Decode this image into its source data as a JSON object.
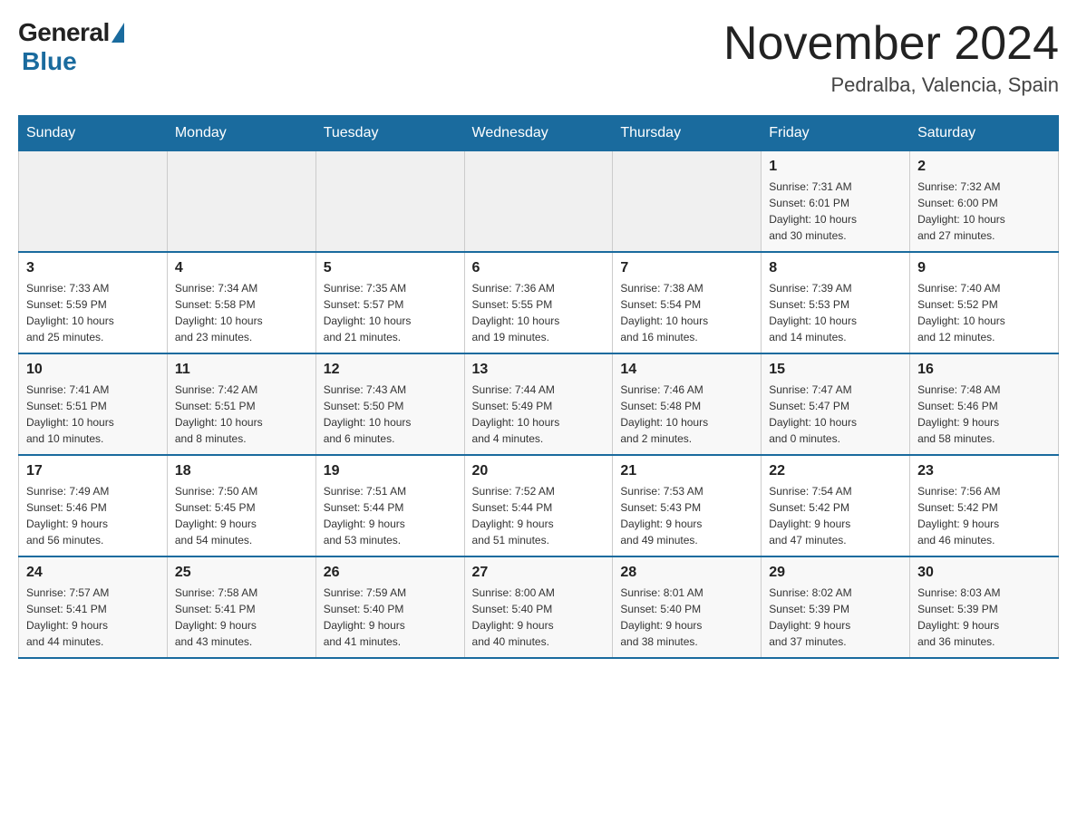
{
  "logo": {
    "general_text": "General",
    "blue_text": "Blue"
  },
  "header": {
    "month_title": "November 2024",
    "location": "Pedralba, Valencia, Spain"
  },
  "weekdays": [
    "Sunday",
    "Monday",
    "Tuesday",
    "Wednesday",
    "Thursday",
    "Friday",
    "Saturday"
  ],
  "weeks": [
    [
      {
        "day": "",
        "info": ""
      },
      {
        "day": "",
        "info": ""
      },
      {
        "day": "",
        "info": ""
      },
      {
        "day": "",
        "info": ""
      },
      {
        "day": "",
        "info": ""
      },
      {
        "day": "1",
        "info": "Sunrise: 7:31 AM\nSunset: 6:01 PM\nDaylight: 10 hours\nand 30 minutes."
      },
      {
        "day": "2",
        "info": "Sunrise: 7:32 AM\nSunset: 6:00 PM\nDaylight: 10 hours\nand 27 minutes."
      }
    ],
    [
      {
        "day": "3",
        "info": "Sunrise: 7:33 AM\nSunset: 5:59 PM\nDaylight: 10 hours\nand 25 minutes."
      },
      {
        "day": "4",
        "info": "Sunrise: 7:34 AM\nSunset: 5:58 PM\nDaylight: 10 hours\nand 23 minutes."
      },
      {
        "day": "5",
        "info": "Sunrise: 7:35 AM\nSunset: 5:57 PM\nDaylight: 10 hours\nand 21 minutes."
      },
      {
        "day": "6",
        "info": "Sunrise: 7:36 AM\nSunset: 5:55 PM\nDaylight: 10 hours\nand 19 minutes."
      },
      {
        "day": "7",
        "info": "Sunrise: 7:38 AM\nSunset: 5:54 PM\nDaylight: 10 hours\nand 16 minutes."
      },
      {
        "day": "8",
        "info": "Sunrise: 7:39 AM\nSunset: 5:53 PM\nDaylight: 10 hours\nand 14 minutes."
      },
      {
        "day": "9",
        "info": "Sunrise: 7:40 AM\nSunset: 5:52 PM\nDaylight: 10 hours\nand 12 minutes."
      }
    ],
    [
      {
        "day": "10",
        "info": "Sunrise: 7:41 AM\nSunset: 5:51 PM\nDaylight: 10 hours\nand 10 minutes."
      },
      {
        "day": "11",
        "info": "Sunrise: 7:42 AM\nSunset: 5:51 PM\nDaylight: 10 hours\nand 8 minutes."
      },
      {
        "day": "12",
        "info": "Sunrise: 7:43 AM\nSunset: 5:50 PM\nDaylight: 10 hours\nand 6 minutes."
      },
      {
        "day": "13",
        "info": "Sunrise: 7:44 AM\nSunset: 5:49 PM\nDaylight: 10 hours\nand 4 minutes."
      },
      {
        "day": "14",
        "info": "Sunrise: 7:46 AM\nSunset: 5:48 PM\nDaylight: 10 hours\nand 2 minutes."
      },
      {
        "day": "15",
        "info": "Sunrise: 7:47 AM\nSunset: 5:47 PM\nDaylight: 10 hours\nand 0 minutes."
      },
      {
        "day": "16",
        "info": "Sunrise: 7:48 AM\nSunset: 5:46 PM\nDaylight: 9 hours\nand 58 minutes."
      }
    ],
    [
      {
        "day": "17",
        "info": "Sunrise: 7:49 AM\nSunset: 5:46 PM\nDaylight: 9 hours\nand 56 minutes."
      },
      {
        "day": "18",
        "info": "Sunrise: 7:50 AM\nSunset: 5:45 PM\nDaylight: 9 hours\nand 54 minutes."
      },
      {
        "day": "19",
        "info": "Sunrise: 7:51 AM\nSunset: 5:44 PM\nDaylight: 9 hours\nand 53 minutes."
      },
      {
        "day": "20",
        "info": "Sunrise: 7:52 AM\nSunset: 5:44 PM\nDaylight: 9 hours\nand 51 minutes."
      },
      {
        "day": "21",
        "info": "Sunrise: 7:53 AM\nSunset: 5:43 PM\nDaylight: 9 hours\nand 49 minutes."
      },
      {
        "day": "22",
        "info": "Sunrise: 7:54 AM\nSunset: 5:42 PM\nDaylight: 9 hours\nand 47 minutes."
      },
      {
        "day": "23",
        "info": "Sunrise: 7:56 AM\nSunset: 5:42 PM\nDaylight: 9 hours\nand 46 minutes."
      }
    ],
    [
      {
        "day": "24",
        "info": "Sunrise: 7:57 AM\nSunset: 5:41 PM\nDaylight: 9 hours\nand 44 minutes."
      },
      {
        "day": "25",
        "info": "Sunrise: 7:58 AM\nSunset: 5:41 PM\nDaylight: 9 hours\nand 43 minutes."
      },
      {
        "day": "26",
        "info": "Sunrise: 7:59 AM\nSunset: 5:40 PM\nDaylight: 9 hours\nand 41 minutes."
      },
      {
        "day": "27",
        "info": "Sunrise: 8:00 AM\nSunset: 5:40 PM\nDaylight: 9 hours\nand 40 minutes."
      },
      {
        "day": "28",
        "info": "Sunrise: 8:01 AM\nSunset: 5:40 PM\nDaylight: 9 hours\nand 38 minutes."
      },
      {
        "day": "29",
        "info": "Sunrise: 8:02 AM\nSunset: 5:39 PM\nDaylight: 9 hours\nand 37 minutes."
      },
      {
        "day": "30",
        "info": "Sunrise: 8:03 AM\nSunset: 5:39 PM\nDaylight: 9 hours\nand 36 minutes."
      }
    ]
  ]
}
